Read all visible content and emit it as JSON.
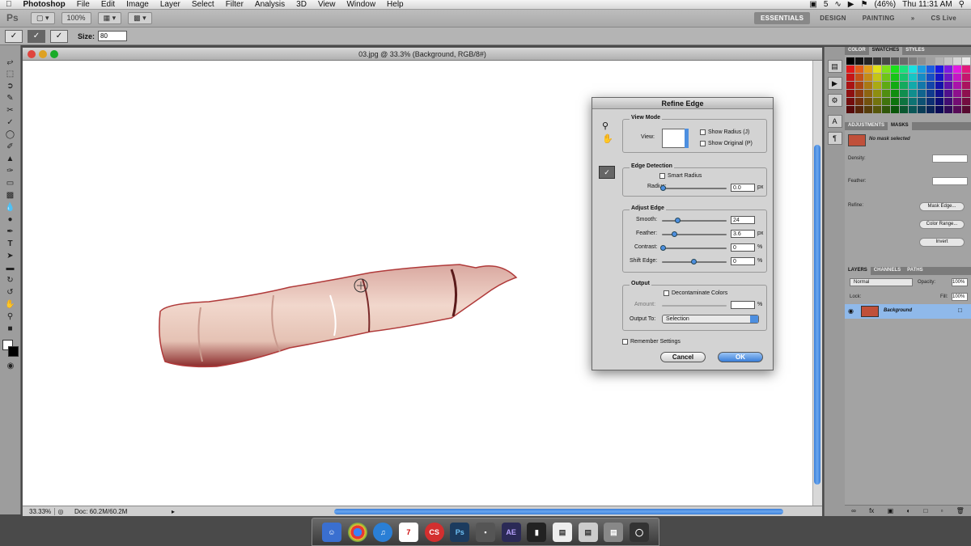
{
  "menubar": {
    "app": "Photoshop",
    "items": [
      "File",
      "Edit",
      "Image",
      "Layer",
      "Select",
      "Filter",
      "Analysis",
      "3D",
      "View",
      "Window",
      "Help"
    ],
    "battery": "(46%)",
    "clock": "Thu 11:31 AM",
    "badge": "5"
  },
  "appbar": {
    "logo": "Ps",
    "zoom": "100%",
    "workspaces": [
      "ESSENTIALS",
      "DESIGN",
      "PAINTING"
    ],
    "cslive": "CS Live"
  },
  "options": {
    "size_label": "Size:",
    "size_value": "80"
  },
  "document": {
    "title": "03.jpg @ 33.3% (Background, RGB/8#)",
    "zoom": "33.33%",
    "doc_size": "Doc: 60.2M/60.2M"
  },
  "dialog": {
    "title": "Refine Edge",
    "view_mode": {
      "label": "View Mode",
      "view_label": "View:",
      "show_radius": "Show Radius (J)",
      "show_original": "Show Original (P)"
    },
    "edge_detection": {
      "label": "Edge Detection",
      "smart_radius": "Smart Radius",
      "radius_label": "Radius:",
      "radius_value": "0.0",
      "radius_unit": "px"
    },
    "adjust_edge": {
      "label": "Adjust Edge",
      "smooth_label": "Smooth:",
      "smooth_value": "24",
      "feather_label": "Feather:",
      "feather_value": "3.6",
      "feather_unit": "px",
      "contrast_label": "Contrast:",
      "contrast_value": "0",
      "contrast_unit": "%",
      "shift_label": "Shift Edge:",
      "shift_value": "0",
      "shift_unit": "%"
    },
    "output": {
      "label": "Output",
      "decontaminate": "Decontaminate Colors",
      "amount_label": "Amount:",
      "amount_unit": "%",
      "output_to_label": "Output To:",
      "output_to_value": "Selection"
    },
    "remember": "Remember Settings",
    "cancel": "Cancel",
    "ok": "OK"
  },
  "panels": {
    "color_tabs": [
      "COLOR",
      "SWATCHES",
      "STYLES"
    ],
    "adj_tabs": [
      "ADJUSTMENTS",
      "MASKS"
    ],
    "no_mask": "No mask selected",
    "density": "Density:",
    "feather": "Feather:",
    "refine": "Refine:",
    "mask_edge": "Mask Edge...",
    "color_range": "Color Range...",
    "invert": "Invert",
    "layer_tabs": [
      "LAYERS",
      "CHANNELS",
      "PATHS"
    ],
    "blend": "Normal",
    "opacity_label": "Opacity:",
    "opacity": "100%",
    "lock_label": "Lock:",
    "fill_label": "Fill:",
    "fill": "100%",
    "layer_name": "Background"
  },
  "dock_apps": [
    "AE"
  ]
}
